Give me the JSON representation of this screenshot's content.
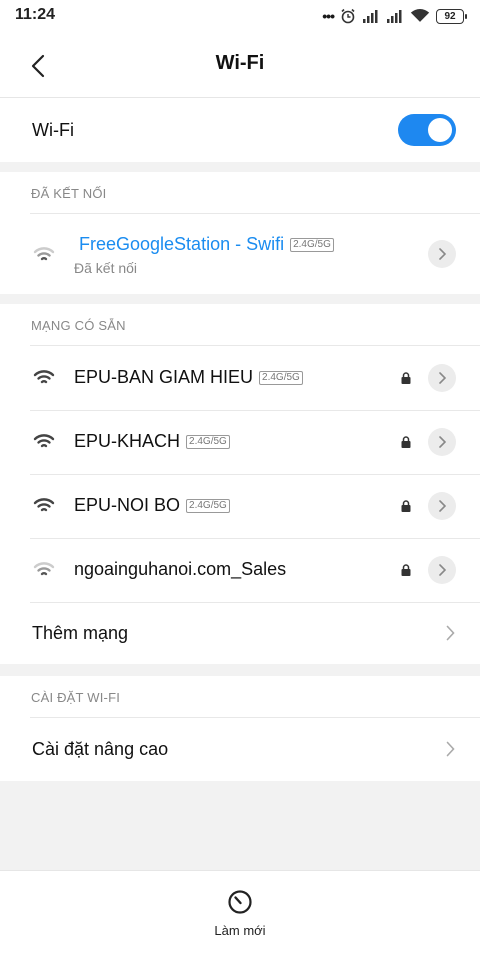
{
  "status": {
    "time": "11:24",
    "battery": "92",
    "signal": "•••"
  },
  "header": {
    "title": "Wi-Fi"
  },
  "wifi_toggle": {
    "label": "Wi-Fi",
    "on": true
  },
  "connected": {
    "title": "ĐÃ KẾT NỐI",
    "network": {
      "name": "FreeGoogleStation - Swifi",
      "band": "2.4G/5G",
      "status": "Đã kết nối",
      "color": "#1a8cf0"
    }
  },
  "available": {
    "title": "MẠNG CÓ SẴN",
    "networks": [
      {
        "name": "EPU-BAN GIAM HIEU",
        "band": "2.4G/5G",
        "locked": true
      },
      {
        "name": "EPU-KHACH",
        "band": "2.4G/5G",
        "locked": true
      },
      {
        "name": "EPU-NOI BO",
        "band": "2.4G/5G",
        "locked": true
      },
      {
        "name": "ngoainguhanoi.com_Sales",
        "band": "",
        "locked": true
      }
    ],
    "add_network": "Thêm mạng"
  },
  "settings": {
    "title": "CÀI ĐẶT WI-FI",
    "advanced": "Cài đặt nâng cao"
  },
  "bottom": {
    "refresh": "Làm mới"
  },
  "colors": {
    "accent": "#1e88f0",
    "background": "#f2f2f2"
  }
}
